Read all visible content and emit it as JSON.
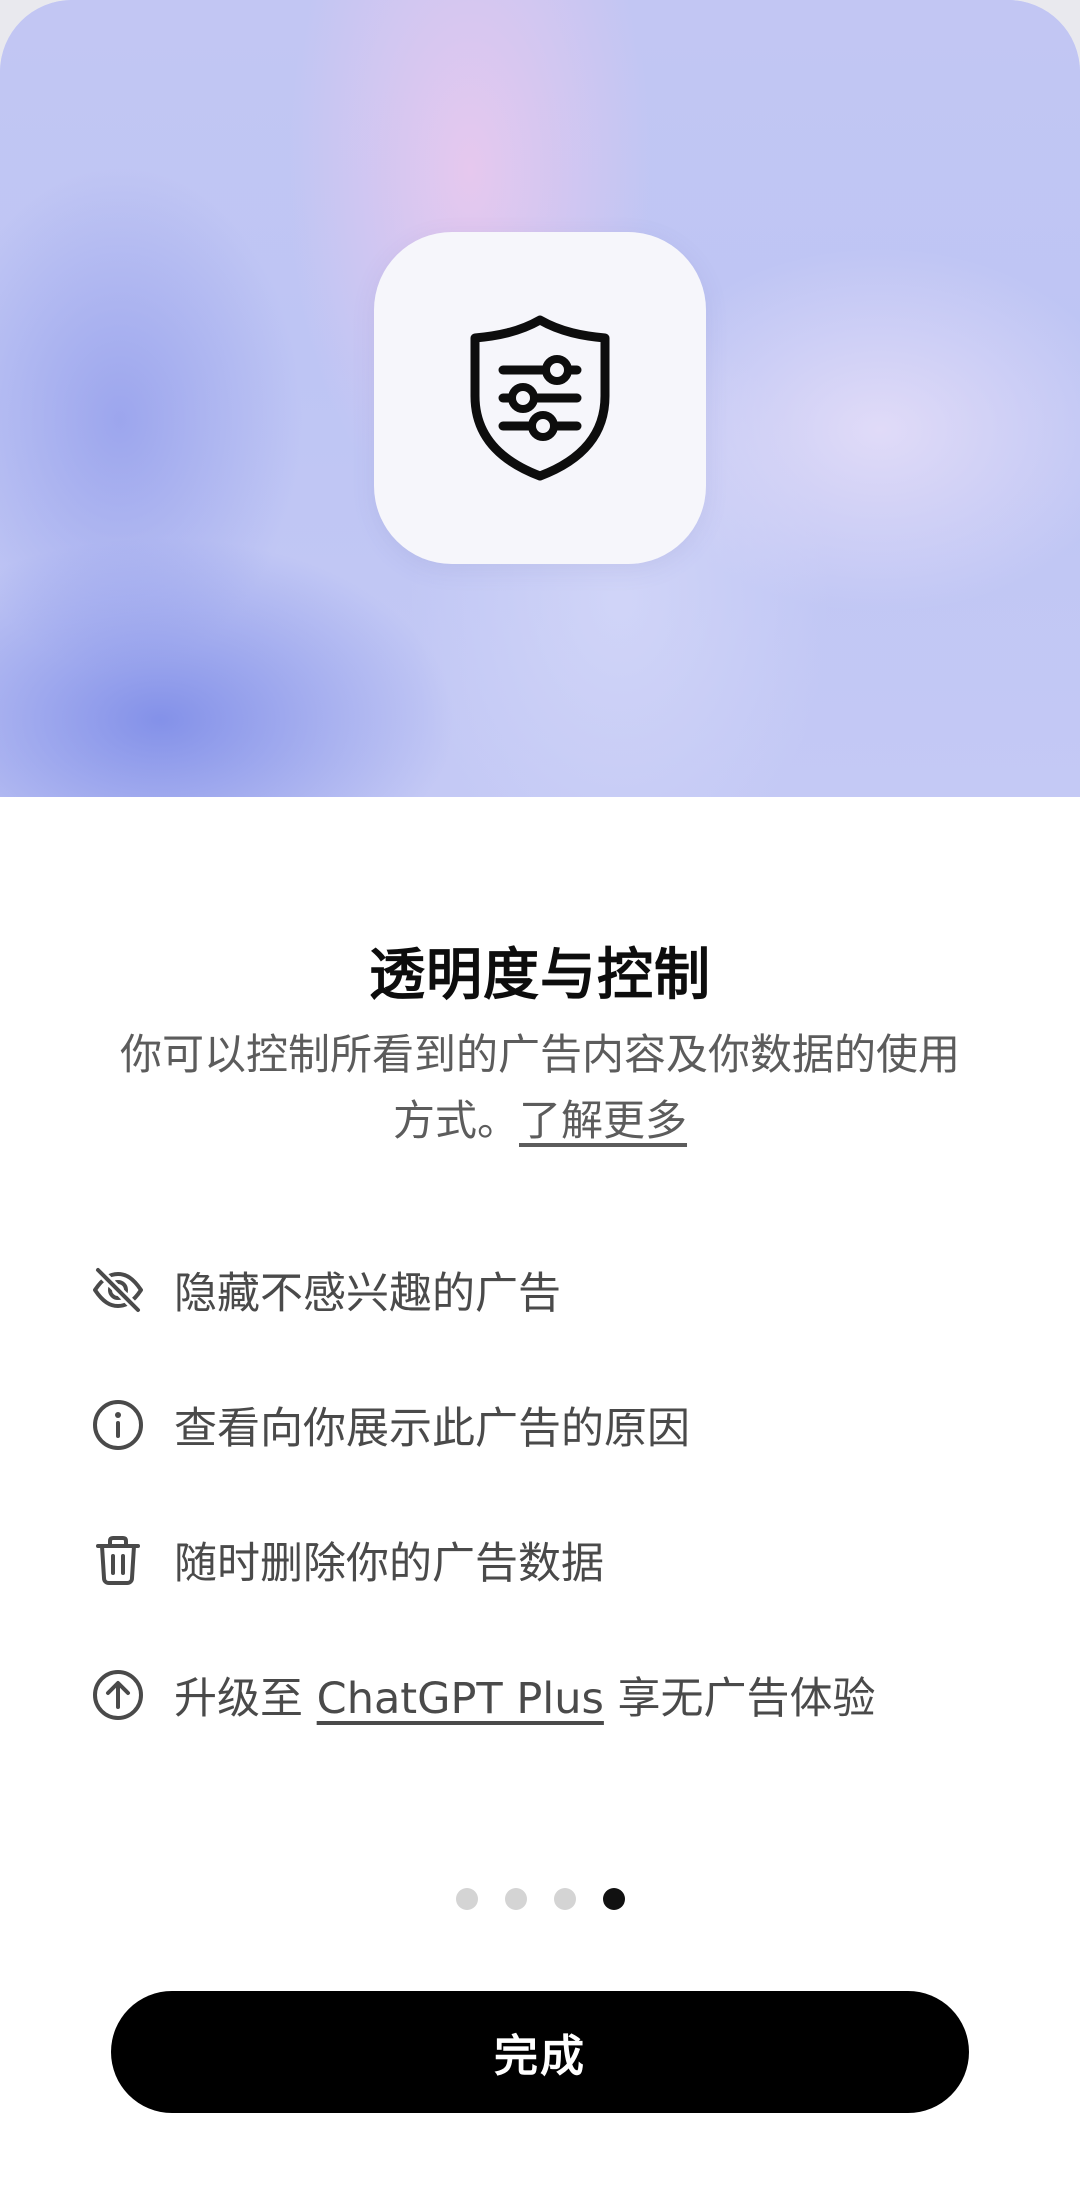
{
  "hero": {
    "icon": "shield-sliders-icon"
  },
  "content": {
    "title": "透明度与控制",
    "subtitle_line1": "你可以控制所看到的广告内容及你数据的使用",
    "subtitle_line2_prefix": "方式。",
    "learn_more": "了解更多"
  },
  "features": [
    {
      "icon": "eye-slash-icon",
      "text": "隐藏不感兴趣的广告"
    },
    {
      "icon": "info-circle-icon",
      "text": "查看向你展示此广告的原因"
    },
    {
      "icon": "trash-icon",
      "text": "随时删除你的广告数据"
    },
    {
      "icon": "arrow-up-circle-icon",
      "text_prefix": "升级至 ",
      "link": "ChatGPT Plus",
      "text_suffix": " 享无广告体验"
    }
  ],
  "pagination": {
    "total": 4,
    "current": 4
  },
  "done_button": {
    "label": "完成"
  },
  "colors": {
    "button_bg": "#000000",
    "text_primary": "#0d0d0d",
    "text_secondary": "#5c5c5c",
    "dot_inactive": "#d4d4d4",
    "dot_active": "#111111"
  }
}
